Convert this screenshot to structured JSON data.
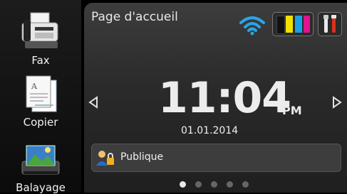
{
  "sidebar": {
    "items": [
      {
        "label": "Fax",
        "icon": "fax-machine-icon"
      },
      {
        "label": "Copier",
        "icon": "copy-document-icon"
      },
      {
        "label": "Balayage",
        "icon": "scanner-icon"
      }
    ]
  },
  "header": {
    "title": "Page d'accueil",
    "icons": [
      "wifi-icon",
      "ink-levels-icon",
      "settings-tools-icon"
    ]
  },
  "clock": {
    "time": "11:04",
    "meridiem": "PM",
    "date": "01.01.2014"
  },
  "user": {
    "label": "Publique",
    "icon": "user-lock-icon"
  },
  "pager": {
    "page_count": 5,
    "active_index": 0
  },
  "colors": {
    "wifi": "#2aa4e8",
    "ink_black": "#111111",
    "ink_yellow": "#f4e000",
    "ink_cyan": "#1aa0e6",
    "ink_magenta": "#e0148c",
    "tools_red": "#d8301c"
  }
}
